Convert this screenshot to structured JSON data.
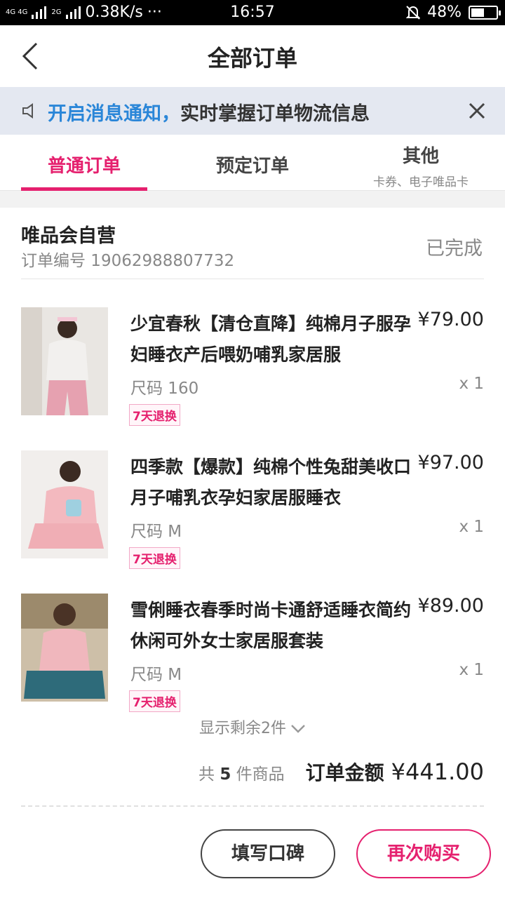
{
  "status_bar": {
    "network": "4G 4G",
    "signal2": "2G",
    "speed": "0.38K/s",
    "dots": "···",
    "time": "16:57",
    "battery": "48%",
    "battery_level": 0.48
  },
  "nav": {
    "title": "全部订单"
  },
  "notice": {
    "highlight": "开启消息通知，",
    "text": "实时掌握订单物流信息"
  },
  "tabs": [
    {
      "label": "普通订单",
      "sub": ""
    },
    {
      "label": "预定订单",
      "sub": ""
    },
    {
      "label": "其他",
      "sub": "卡券、电子唯品卡"
    }
  ],
  "order": {
    "shop_name": "唯品会自营",
    "order_no": "订单编号 19062988807732",
    "status": "已完成",
    "items": [
      {
        "name": "少宜春秋【清仓直降】纯棉月子服孕妇睡衣产后喂奶哺乳家居服",
        "price": "¥79.00",
        "size": "尺码 160",
        "qty": "x 1",
        "tag": "7天退换"
      },
      {
        "name": "四季款【爆款】纯棉个性兔甜美收口月子哺乳衣孕妇家居服睡衣",
        "price": "¥97.00",
        "size": "尺码 M",
        "qty": "x 1",
        "tag": "7天退换"
      },
      {
        "name": "雪俐睡衣春季时尚卡通舒适睡衣简约休闲可外女士家居服套装",
        "price": "¥89.00",
        "size": "尺码 M",
        "qty": "x 1",
        "tag": "7天退换"
      }
    ],
    "show_more": "显示剩余2件",
    "count_prefix": "共",
    "count": "5",
    "count_suffix": "件商品",
    "total_label": "订单金额",
    "total_amount": "¥441.00"
  },
  "actions": {
    "review": "填写口碑",
    "rebuy": "再次购买"
  },
  "colors": {
    "accent": "#e5206e",
    "link": "#2a86d8",
    "notice_bg": "#e4e8f1"
  }
}
